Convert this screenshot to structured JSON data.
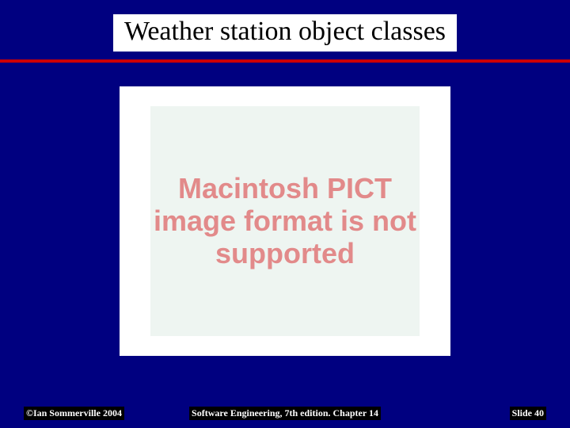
{
  "slide": {
    "title": "Weather station object classes",
    "error_message": "Macintosh PICT image format is not supported"
  },
  "footer": {
    "copyright": "©Ian Sommerville 2004",
    "center": "Software Engineering, 7th edition. Chapter 14",
    "page": "Slide 40"
  }
}
